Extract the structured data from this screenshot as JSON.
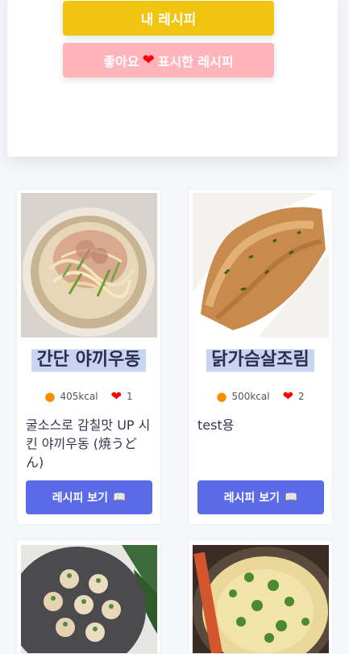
{
  "header": {
    "my_recipes_label": "내 레시피",
    "liked_prefix": "좋아요",
    "liked_suffix": "표시한 레시피"
  },
  "recipes": [
    {
      "title": "간단 야끼우동",
      "kcal": "405kcal",
      "likes": "1",
      "description": "굴소스로 감칠맛 UP 시킨 야끼우동 (焼うどん)",
      "view_label": "레시피 보기",
      "image": "yaki-udon-plate"
    },
    {
      "title": "닭가슴살조림",
      "kcal": "500kcal",
      "likes": "2",
      "description": "test용",
      "view_label": "레시피 보기",
      "image": "braised-chicken-breast"
    }
  ],
  "more_recipes": [
    {
      "image": "stuffed-bites-dark-plate"
    },
    {
      "image": "herb-omelette-pan"
    }
  ],
  "colors": {
    "primary_button": "#5b6be8",
    "my_recipes_button": "#f1c40f",
    "liked_button": "#ffb3ba",
    "title_highlight": "#c9d4f3"
  },
  "icons": {
    "heart": "heart-icon",
    "calorie": "fire-icon",
    "book": "book-icon"
  }
}
